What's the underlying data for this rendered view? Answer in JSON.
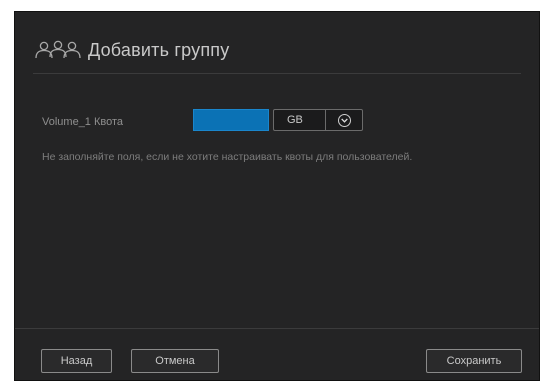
{
  "dialog": {
    "title": "Добавить группу",
    "header_icon": "group-users-icon"
  },
  "quota": {
    "label": "Volume_1 Квота",
    "value": "",
    "unit": "GB",
    "unit_dropdown_icon": "chevron-down-icon"
  },
  "hint": "Не заполняйте поля, если не хотите настраивать квоты для пользователей.",
  "footer": {
    "back_label": "Назад",
    "cancel_label": "Отмена",
    "save_label": "Сохранить"
  },
  "colors": {
    "dialog_background": "#242425",
    "input_accent": "#0b72b5",
    "text_primary": "#c9c9c9",
    "text_muted": "#7d7d7d"
  }
}
